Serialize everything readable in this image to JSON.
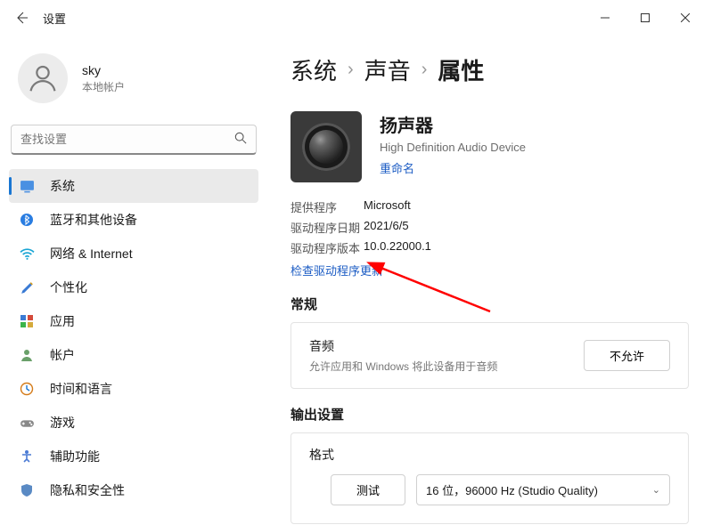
{
  "titlebar": {
    "title": "设置"
  },
  "user": {
    "name": "sky",
    "type": "本地帐户"
  },
  "search": {
    "placeholder": "查找设置"
  },
  "nav": [
    {
      "label": "系统"
    },
    {
      "label": "蓝牙和其他设备"
    },
    {
      "label": "网络 & Internet"
    },
    {
      "label": "个性化"
    },
    {
      "label": "应用"
    },
    {
      "label": "帐户"
    },
    {
      "label": "时间和语言"
    },
    {
      "label": "游戏"
    },
    {
      "label": "辅助功能"
    },
    {
      "label": "隐私和安全性"
    }
  ],
  "breadcrumb": {
    "level1": "系统",
    "level2": "声音",
    "current": "属性"
  },
  "device": {
    "name": "扬声器",
    "sub": "High Definition Audio Device",
    "rename": "重命名"
  },
  "specs": {
    "providerLabel": "提供程序",
    "providerValue": "Microsoft",
    "dateLabel": "驱动程序日期",
    "dateValue": "2021/6/5",
    "versionLabel": "驱动程序版本",
    "versionValue": "10.0.22000.1",
    "updateLink": "检查驱动程序更新"
  },
  "sections": {
    "general": "常规",
    "audio": {
      "title": "音频",
      "sub": "允许应用和 Windows 将此设备用于音频",
      "action": "不允许"
    },
    "output": "输出设置",
    "format": {
      "title": "格式",
      "test": "测试",
      "selected": "16 位，96000 Hz (Studio Quality)"
    }
  }
}
